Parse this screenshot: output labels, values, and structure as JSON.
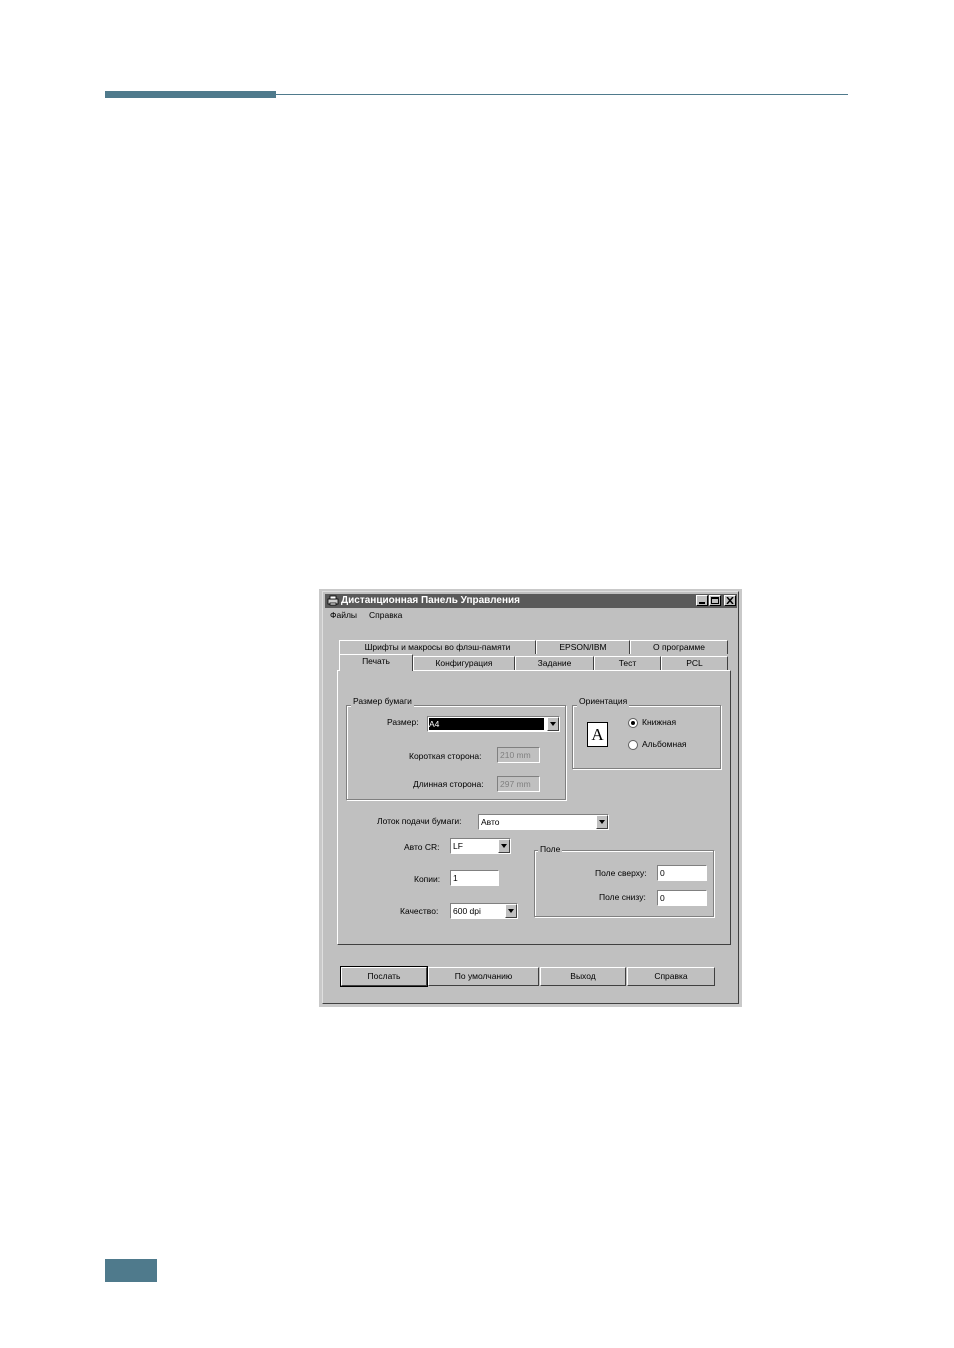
{
  "page": {
    "accent_color": "#4f7a8c"
  },
  "window": {
    "title": "Дистанционная Панель Управления",
    "icon": "printer-icon",
    "controls": [
      "minimize-icon",
      "maximize-icon",
      "close-icon"
    ]
  },
  "menu": {
    "items": [
      "Файлы",
      "Справка"
    ]
  },
  "tabs": {
    "row_top": [
      "Шрифты и макросы во флэш-памяти",
      "EPSON/IBM",
      "О программе"
    ],
    "row_bottom": [
      "Печать",
      "Конфигурация",
      "Задание",
      "Тест",
      "PCL"
    ],
    "active": "Печать"
  },
  "paper_size": {
    "group_label": "Размер бумаги",
    "size_label": "Размер:",
    "size_value": "A4",
    "short_side_label": "Короткая сторона:",
    "short_side_value": "210 mm",
    "long_side_label": "Длинная сторона:",
    "long_side_value": "297 mm"
  },
  "orientation": {
    "group_label": "Ориентация",
    "icon_letter": "A",
    "portrait_label": "Книжная",
    "landscape_label": "Альбомная",
    "selected": "Книжная"
  },
  "tray": {
    "label": "Лоток подачи бумаги:",
    "value": "Авто"
  },
  "auto_cr": {
    "label": "Авто CR:",
    "value": "LF"
  },
  "copies": {
    "label": "Копии:",
    "value": "1"
  },
  "quality": {
    "label": "Качество:",
    "value": "600 dpi"
  },
  "margins": {
    "group_label": "Поле",
    "top_label": "Поле сверху:",
    "top_value": "0",
    "bottom_label": "Поле снизу:",
    "bottom_value": "0"
  },
  "buttons": {
    "send": "Послать",
    "defaults": "По умолчанию",
    "exit": "Выход",
    "help": "Справка"
  }
}
